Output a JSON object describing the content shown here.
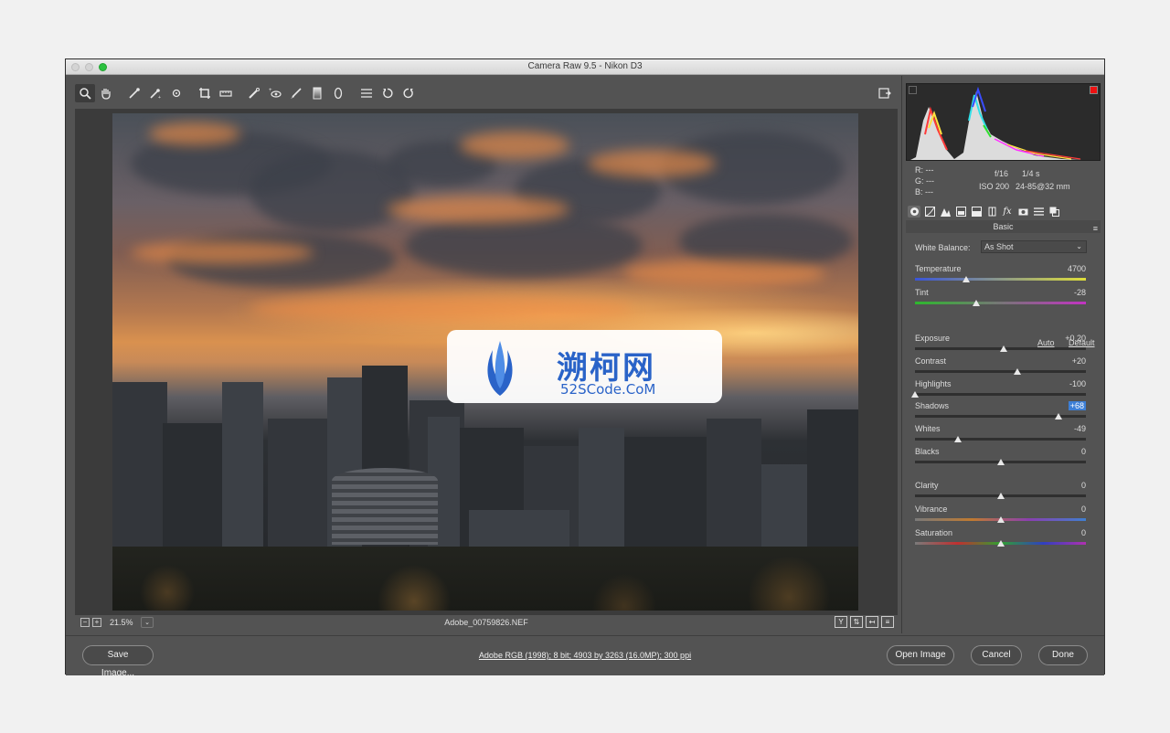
{
  "window": {
    "title": "Camera Raw 9.5  -  Nikon D3"
  },
  "toolbar": {
    "tools": [
      "zoom-icon",
      "hand-icon",
      "white-balance-icon",
      "color-sampler-icon",
      "targeted-adjustment-icon",
      "crop-icon",
      "straighten-icon",
      "spot-removal-icon",
      "red-eye-icon",
      "adjustment-brush-icon",
      "graduated-filter-icon",
      "radial-filter-icon",
      "preferences-icon",
      "rotate-left-icon",
      "rotate-right-icon"
    ],
    "toggle": "fullscreen-icon"
  },
  "preview": {
    "zoom_minus": "−",
    "zoom_plus": "+",
    "zoom": "21.5%",
    "zoom_dropdown": "⌄",
    "filename": "Adobe_00759826.NEF",
    "view_buttons": [
      "Y",
      "⇅",
      "↤",
      "≡"
    ]
  },
  "watermark": {
    "title": "溯柯网",
    "subtitle": "52SCode.CoM"
  },
  "histogram": {
    "r": "R:  ---",
    "g": "G:  ---",
    "b": "B:  ---",
    "aperture": "f/16",
    "shutter": "1/4 s",
    "iso": "ISO 200",
    "lens": "24-85@32 mm"
  },
  "panel": {
    "tabs": [
      "basic-icon",
      "tone-curve-icon",
      "detail-icon",
      "hsl-icon",
      "split-toning-icon",
      "lens-icon",
      "effects-icon",
      "camera-calibration-icon",
      "presets-icon",
      "snapshots-icon"
    ],
    "section_title": "Basic",
    "white_balance_label": "White Balance:",
    "white_balance_value": "As Shot",
    "auto": "Auto",
    "default": "Default",
    "sliders": {
      "temperature": {
        "label": "Temperature",
        "value": "4700",
        "position": 0.3
      },
      "tint": {
        "label": "Tint",
        "value": "-28",
        "position": 0.36
      },
      "exposure": {
        "label": "Exposure",
        "value": "+0.20",
        "position": 0.52
      },
      "contrast": {
        "label": "Contrast",
        "value": "+20",
        "position": 0.6
      },
      "highlights": {
        "label": "Highlights",
        "value": "-100",
        "position": 0.0
      },
      "shadows": {
        "label": "Shadows",
        "value": "+68",
        "position": 0.84
      },
      "whites": {
        "label": "Whites",
        "value": "-49",
        "position": 0.25
      },
      "blacks": {
        "label": "Blacks",
        "value": "0",
        "position": 0.5
      },
      "clarity": {
        "label": "Clarity",
        "value": "0",
        "position": 0.5
      },
      "vibrance": {
        "label": "Vibrance",
        "value": "0",
        "position": 0.5
      },
      "saturation": {
        "label": "Saturation",
        "value": "0",
        "position": 0.5
      }
    }
  },
  "footer": {
    "save": "Save Image...",
    "workflow": "Adobe RGB (1998); 8 bit; 4903 by 3263 (16.0MP); 300 ppi",
    "open": "Open Image",
    "cancel": "Cancel",
    "done": "Done"
  },
  "colors": {
    "panel_bg": "#535353",
    "accent": "#3d7fd6",
    "watermark_blue": "#2a63c8"
  }
}
